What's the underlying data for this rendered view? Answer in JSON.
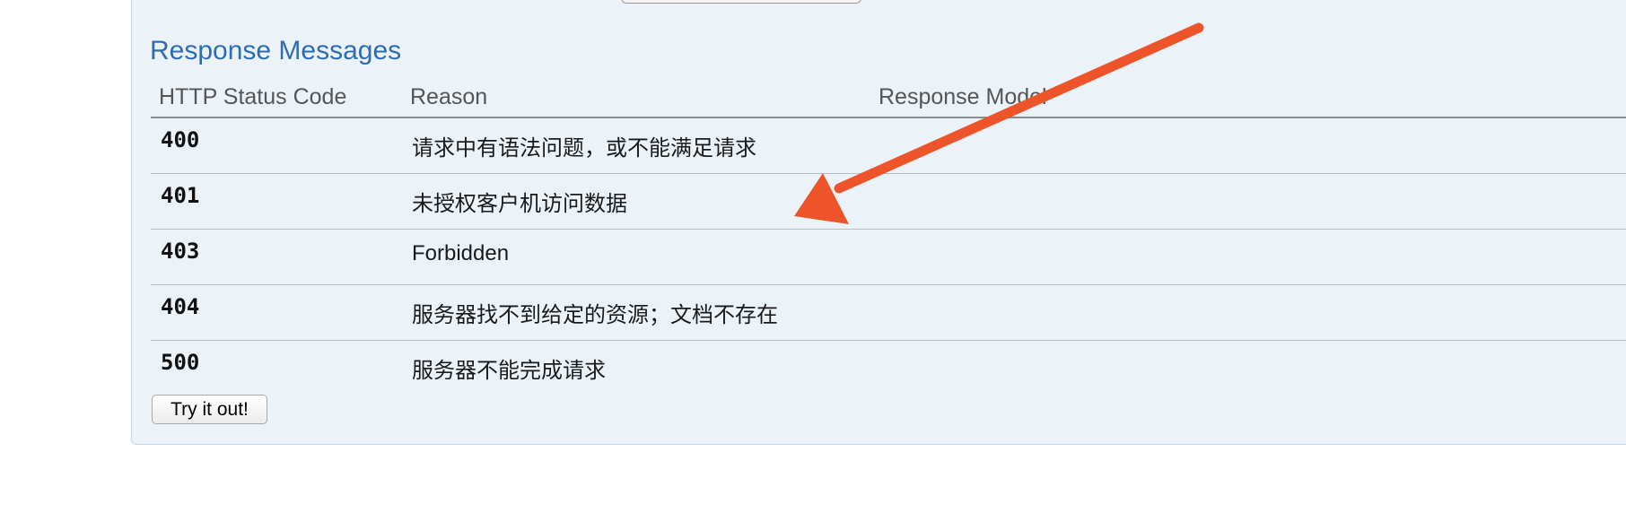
{
  "section": {
    "title": "Response Messages"
  },
  "table": {
    "headers": [
      "HTTP Status Code",
      "Reason",
      "Response Model"
    ],
    "rows": [
      {
        "code": "400",
        "reason": "请求中有语法问题，或不能满足请求"
      },
      {
        "code": "401",
        "reason": "未授权客户机访问数据"
      },
      {
        "code": "403",
        "reason": "Forbidden"
      },
      {
        "code": "404",
        "reason": "服务器找不到给定的资源；文档不存在"
      },
      {
        "code": "500",
        "reason": "服务器不能完成请求"
      }
    ]
  },
  "actions": {
    "try_label": "Try it out!"
  },
  "annotation": {
    "arrow_color": "#ee5429"
  }
}
